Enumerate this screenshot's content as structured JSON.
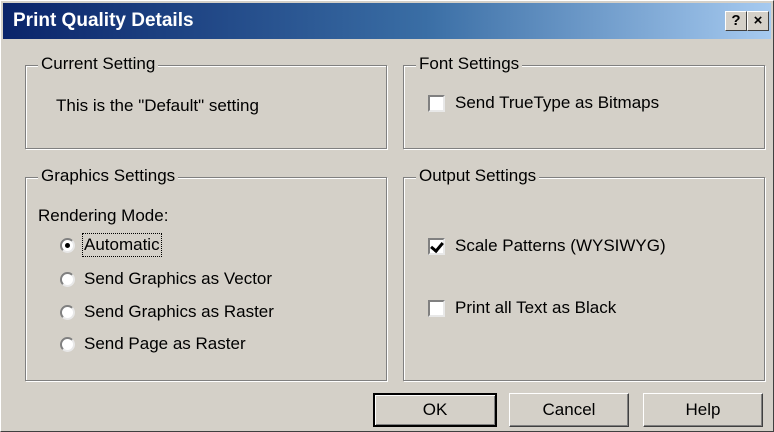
{
  "window": {
    "title": "Print Quality Details",
    "help_button": "?",
    "close_button": "×"
  },
  "current_setting": {
    "legend": "Current Setting",
    "text": "This is the \"Default\" setting"
  },
  "font_settings": {
    "legend": "Font Settings",
    "send_truetype": {
      "label": "Send TrueType as Bitmaps",
      "checked": false
    }
  },
  "graphics_settings": {
    "legend": "Graphics Settings",
    "rendering_mode_label": "Rendering Mode:",
    "options": [
      {
        "label": "Automatic",
        "selected": true
      },
      {
        "label": "Send Graphics as Vector",
        "selected": false
      },
      {
        "label": "Send Graphics as Raster",
        "selected": false
      },
      {
        "label": "Send Page as Raster",
        "selected": false
      }
    ]
  },
  "output_settings": {
    "legend": "Output Settings",
    "scale_patterns": {
      "label": "Scale Patterns (WYSIWYG)",
      "checked": true
    },
    "print_text_black": {
      "label": "Print all Text as Black",
      "checked": false
    }
  },
  "buttons": {
    "ok": "OK",
    "cancel": "Cancel",
    "help": "Help"
  }
}
